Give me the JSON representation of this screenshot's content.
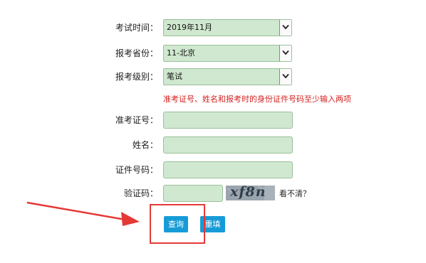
{
  "form": {
    "exam_time": {
      "label": "考试时间：",
      "value": "2019年11月"
    },
    "province": {
      "label": "报考省份：",
      "value": "11-北京"
    },
    "level": {
      "label": "报考级别：",
      "value": "笔试"
    },
    "notice": "准考证号、姓名和报考时的身份证件号码至少输入两项",
    "admission_no": {
      "label": "准考证号：",
      "value": ""
    },
    "name": {
      "label": "姓名：",
      "value": ""
    },
    "id_no": {
      "label": "证件号码：",
      "value": ""
    },
    "captcha": {
      "label": "验证码：",
      "value": "",
      "image_text": "xf8n",
      "refresh_text": "看不清？"
    }
  },
  "buttons": {
    "query": "查询",
    "reset": "重填"
  },
  "annotation": {
    "color": "#e53935"
  }
}
